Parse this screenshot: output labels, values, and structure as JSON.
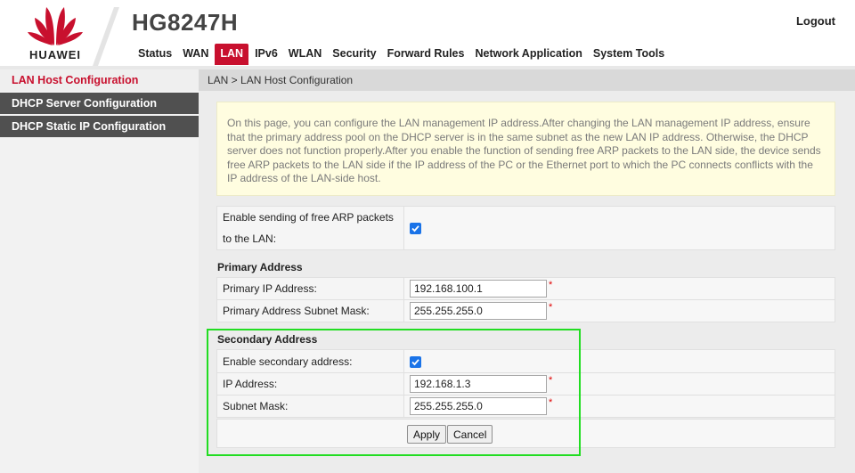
{
  "header": {
    "brand": "HUAWEI",
    "model": "HG8247H",
    "logout_label": "Logout",
    "brand_color": "#c8102e"
  },
  "nav": {
    "items": [
      "Status",
      "WAN",
      "LAN",
      "IPv6",
      "WLAN",
      "Security",
      "Forward Rules",
      "Network Application",
      "System Tools"
    ],
    "active": "LAN"
  },
  "sidebar": {
    "items": [
      "LAN Host Configuration",
      "DHCP Server Configuration",
      "DHCP Static IP Configuration"
    ],
    "active": "LAN Host Configuration"
  },
  "breadcrumb": "LAN > LAN Host Configuration",
  "info_text": "On this page, you can configure the LAN management IP address.After changing the LAN management IP address, ensure that the primary address pool on the DHCP server is in the same subnet as the new LAN IP address. Otherwise, the DHCP server does not function properly.After you enable the function of sending free ARP packets to the LAN side, the device sends free ARP packets to the LAN side if the IP address of the PC or the Ethernet port to which the PC connects conflicts with the IP address of the LAN-side host.",
  "free_arp": {
    "label_line1": "Enable sending of free ARP packets",
    "label_line2": "to the LAN:",
    "checked": true
  },
  "primary": {
    "title": "Primary Address",
    "ip_label": "Primary IP Address:",
    "ip_value": "192.168.100.1",
    "mask_label": "Primary Address Subnet Mask:",
    "mask_value": "255.255.255.0"
  },
  "secondary": {
    "title": "Secondary Address",
    "enable_label": "Enable secondary address:",
    "enabled": true,
    "ip_label": "IP Address:",
    "ip_value": "192.168.1.3",
    "mask_label": "Subnet Mask:",
    "mask_value": "255.255.255.0"
  },
  "required_mark": "*",
  "buttons": {
    "apply": "Apply",
    "cancel": "Cancel"
  },
  "colors": {
    "accent_red": "#c8102e",
    "checkbox_blue": "#1a73e8",
    "highlight_green": "#22dd22",
    "info_bg": "#fffde0"
  }
}
